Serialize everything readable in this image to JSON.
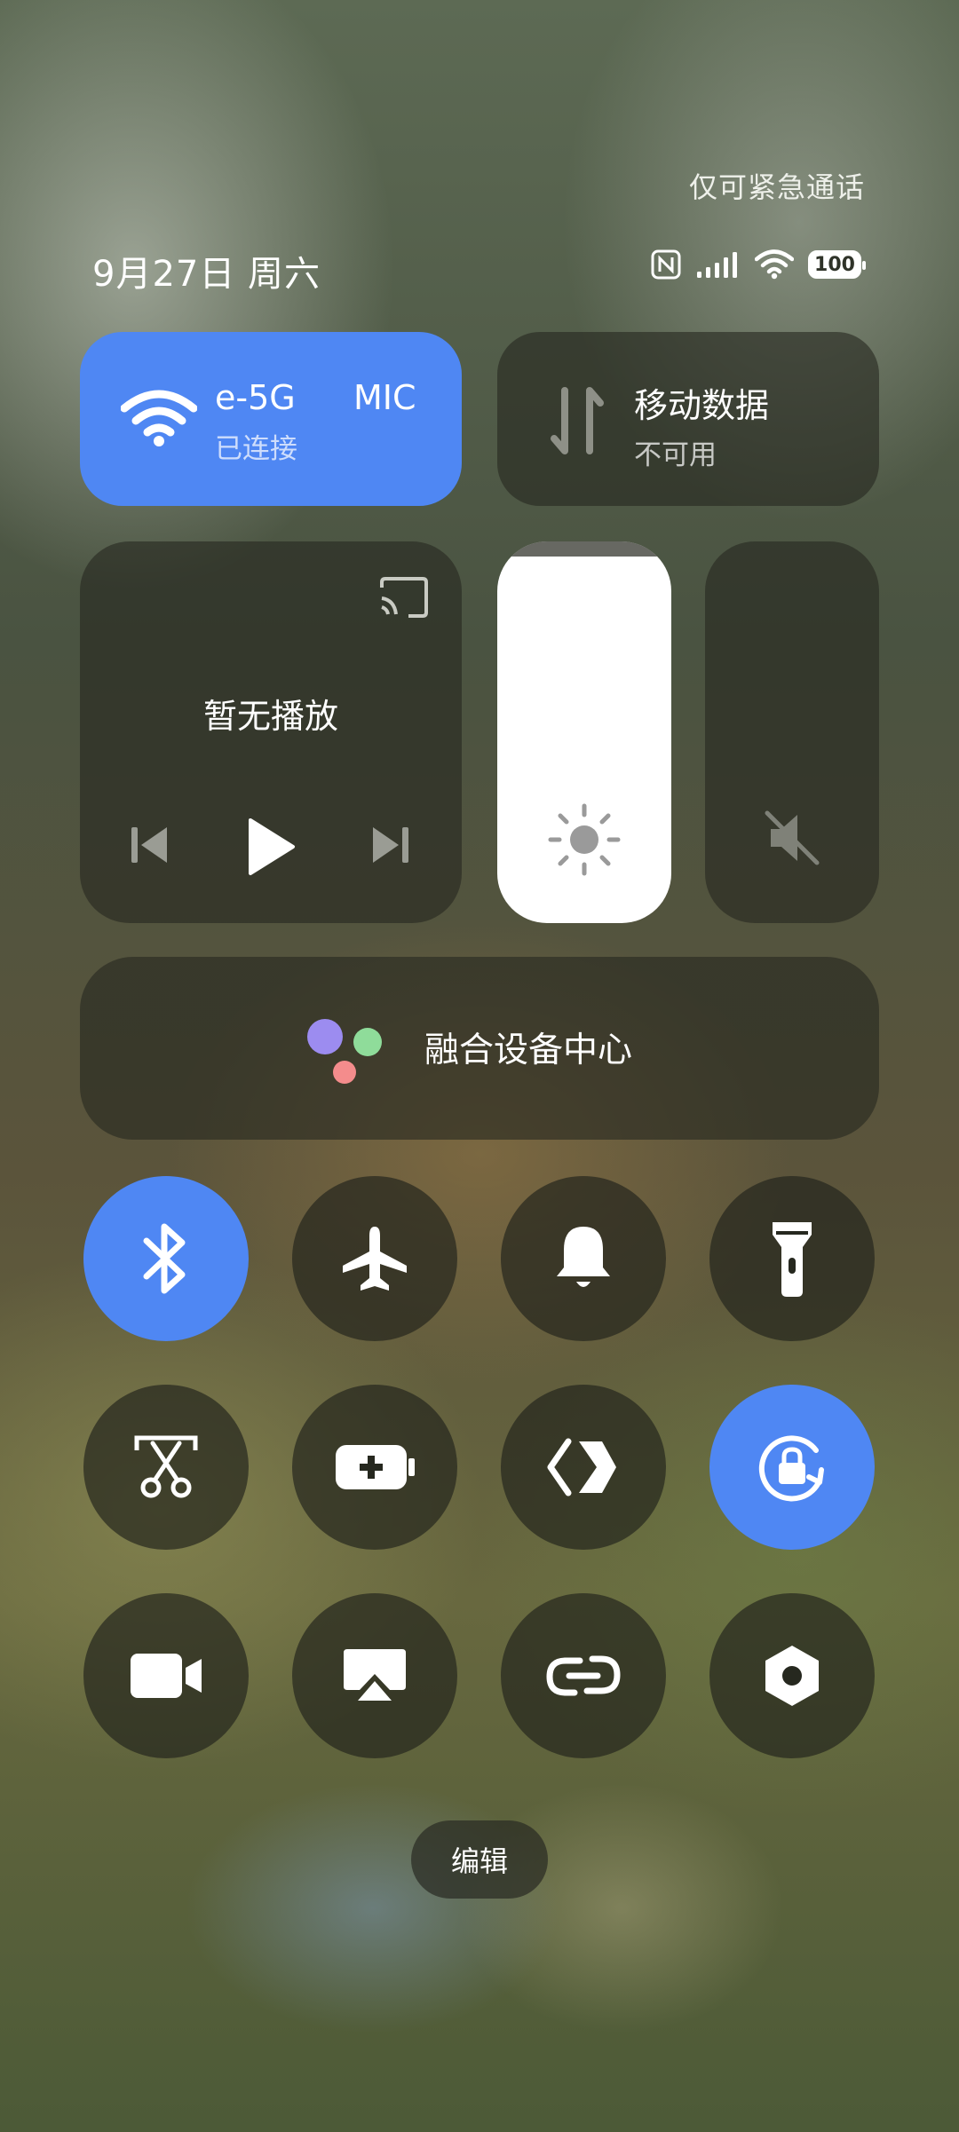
{
  "status_bar": {
    "notice": "仅可紧急通话",
    "date": "9月27日 周六",
    "battery_level": "100",
    "icons": [
      "nfc-icon",
      "signal-icon",
      "wifi-icon",
      "battery-icon"
    ]
  },
  "wifi_tile": {
    "ssid_left": "e-5G",
    "ssid_right": "MIC",
    "status": "已连接",
    "icon": "wifi-icon",
    "active": true
  },
  "mobile_data_tile": {
    "title": "移动数据",
    "status": "不可用",
    "icon": "data-transfer-icon"
  },
  "media": {
    "status": "暂无播放",
    "icons": [
      "cast-icon",
      "previous-icon",
      "play-icon",
      "next-icon"
    ]
  },
  "brightness": {
    "level": 0.96,
    "icon": "sun-icon"
  },
  "volume": {
    "icon": "mute-icon",
    "muted": true
  },
  "device_center": {
    "label": "融合设备中心",
    "icon": "device-center-icon"
  },
  "toggles": [
    {
      "name": "bluetooth",
      "icon": "bluetooth-icon",
      "active": true
    },
    {
      "name": "airplane",
      "icon": "airplane-icon",
      "active": false
    },
    {
      "name": "ring",
      "icon": "bell-icon",
      "active": false
    },
    {
      "name": "flashlight",
      "icon": "flashlight-icon",
      "active": false
    },
    {
      "name": "screenshot",
      "icon": "scissors-icon",
      "active": false
    },
    {
      "name": "battery-saver",
      "icon": "battery-plus-icon",
      "active": false
    },
    {
      "name": "code",
      "icon": "code-icon",
      "active": false
    },
    {
      "name": "rotation-lock",
      "icon": "rotation-lock-icon",
      "active": true
    },
    {
      "name": "screen-record",
      "icon": "video-camera-icon",
      "active": false
    },
    {
      "name": "screen-cast",
      "icon": "airplay-icon",
      "active": false
    },
    {
      "name": "link",
      "icon": "link-icon",
      "active": false
    },
    {
      "name": "settings",
      "icon": "hexagon-icon",
      "active": false
    }
  ],
  "colors": {
    "accent": "#4f87f3",
    "tile": "#26281f"
  },
  "edit_label": "编辑"
}
